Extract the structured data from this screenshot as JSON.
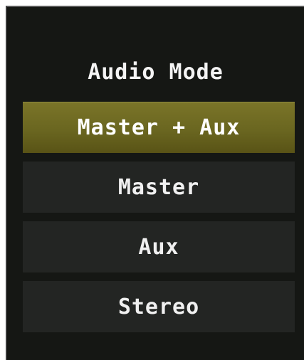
{
  "menu": {
    "title": "Audio Mode",
    "selected_index": 0,
    "items": [
      {
        "label": "Master + Aux"
      },
      {
        "label": "Master"
      },
      {
        "label": "Aux"
      },
      {
        "label": "Stereo"
      }
    ]
  },
  "colors": {
    "background": "#151714",
    "item_background": "#232523",
    "selected_background": "#6a6620",
    "text": "#f0f0f0"
  }
}
